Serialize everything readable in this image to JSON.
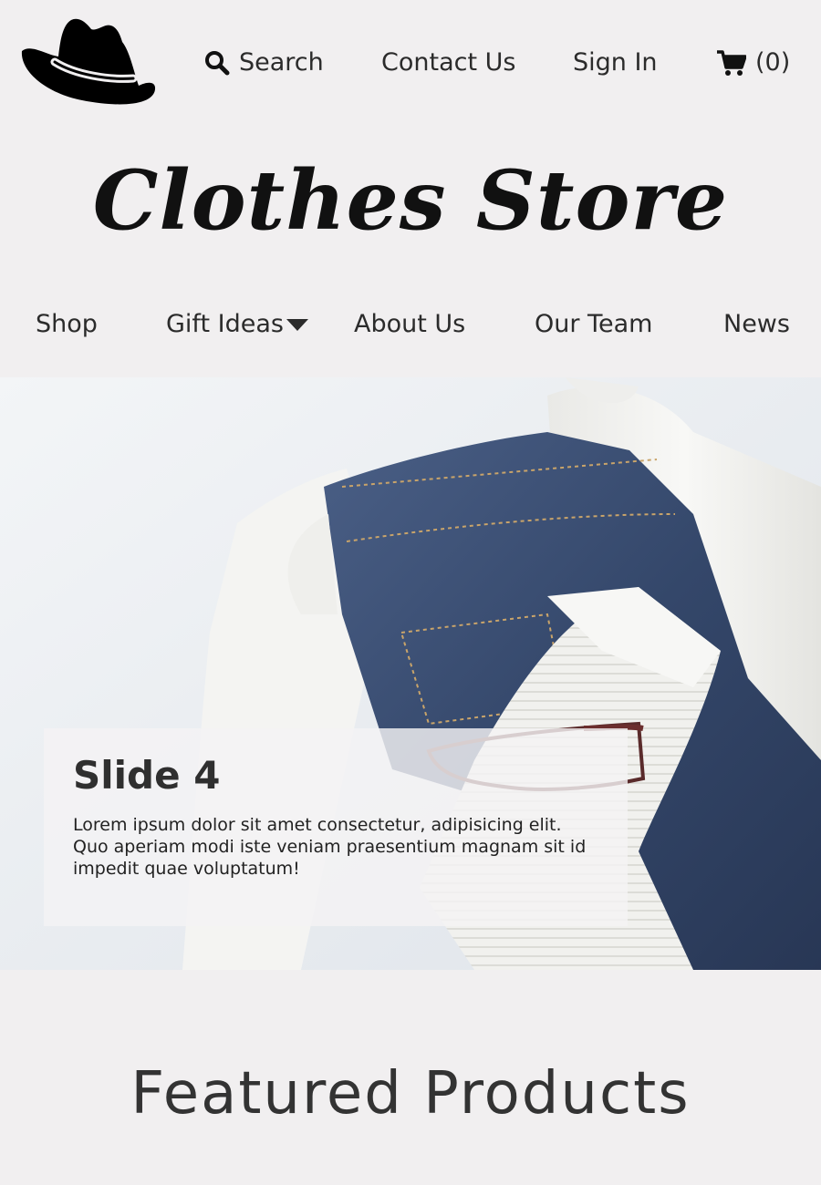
{
  "header": {
    "logo_icon": "cowboy-hat-icon",
    "search_label": "Search",
    "search_icon": "search-icon",
    "contact_label": "Contact Us",
    "signin_label": "Sign In",
    "cart_icon": "cart-icon",
    "cart_count_label": "(0)"
  },
  "brand": {
    "title": "Clothes Store"
  },
  "nav": {
    "items": [
      {
        "label": "Shop"
      },
      {
        "label": "Gift Ideas",
        "has_dropdown": true
      },
      {
        "label": "About Us"
      },
      {
        "label": "Our Team"
      },
      {
        "label": "News"
      }
    ]
  },
  "hero": {
    "slide_title": "Slide 4",
    "slide_text": "Lorem ipsum dolor sit amet consectetur, adipisicing elit. Quo aperiam modi iste veniam praesentium magnam sit id impedit quae voluptatum!"
  },
  "featured": {
    "heading": "Featured Products"
  },
  "colors": {
    "background": "#f1eff0",
    "text": "#2b2b2b",
    "denim": "#34476a",
    "knit": "#f2f2f0"
  }
}
